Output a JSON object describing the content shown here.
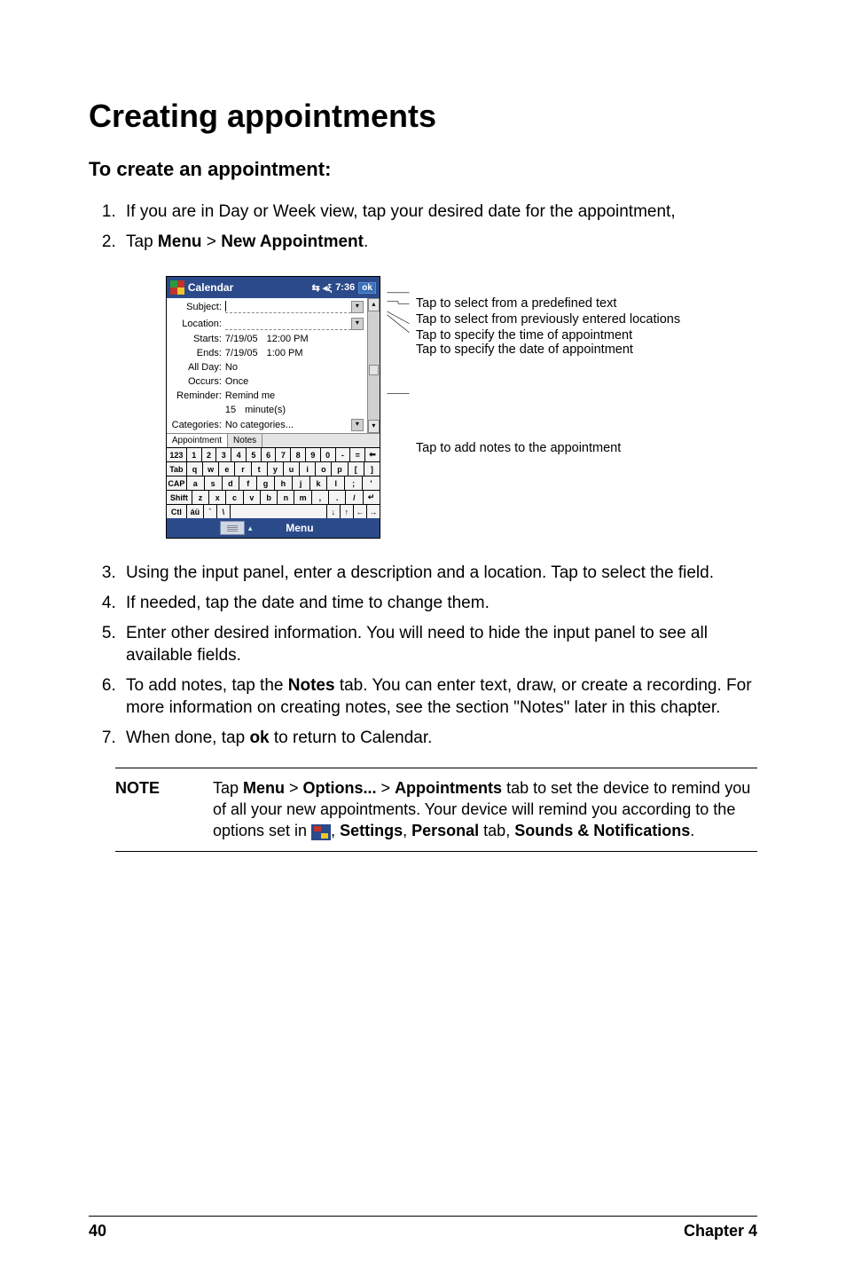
{
  "h1": "Creating appointments",
  "h2": "To create an appointment:",
  "steps_a": [
    "If you are in Day or Week view, tap your desired date for the appointment,",
    {
      "pre": "Tap ",
      "b1": "Menu",
      "mid": " > ",
      "b2": "New Appointment",
      "post": "."
    }
  ],
  "device": {
    "title": "Calendar",
    "time": "7:36",
    "ok": "ok",
    "fields": {
      "subject_lbl": "Subject:",
      "location_lbl": "Location:",
      "starts_lbl": "Starts:",
      "starts_date": "7/19/05",
      "starts_time": "12:00 PM",
      "ends_lbl": "Ends:",
      "ends_date": "7/19/05",
      "ends_time": "1:00 PM",
      "allday_lbl": "All Day:",
      "allday_val": "No",
      "occurs_lbl": "Occurs:",
      "occurs_val": "Once",
      "reminder_lbl": "Reminder:",
      "reminder_val": "Remind me",
      "reminder_num": "15",
      "reminder_unit": "minute(s)",
      "categories_lbl": "Categories:",
      "categories_val": "No categories..."
    },
    "tabs": {
      "appointment": "Appointment",
      "notes": "Notes"
    },
    "kbd": {
      "r1_lead": "123",
      "r1": [
        "1",
        "2",
        "3",
        "4",
        "5",
        "6",
        "7",
        "8",
        "9",
        "0",
        "-",
        "="
      ],
      "r1_tail": "⬅",
      "r2_lead": "Tab",
      "r2": [
        "q",
        "w",
        "e",
        "r",
        "t",
        "y",
        "u",
        "i",
        "o",
        "p",
        "[",
        "]"
      ],
      "r3_lead": "CAP",
      "r3": [
        "a",
        "s",
        "d",
        "f",
        "g",
        "h",
        "j",
        "k",
        "l",
        ";",
        "'"
      ],
      "r4_lead": "Shift",
      "r4": [
        "z",
        "x",
        "c",
        "v",
        "b",
        "n",
        "m",
        ",",
        ".",
        "/"
      ],
      "r4_tail": "↵",
      "r5_lead": "Ctl",
      "r5_1": "áü",
      "r5_2": "`",
      "r5_3": "\\",
      "r5_arrows": [
        "↓",
        "↑",
        "←",
        "→"
      ]
    },
    "softbar_menu": "Menu"
  },
  "annotations": {
    "a1": "Tap to select from a predefined text",
    "a2": "Tap to select from previously entered locations",
    "a3": "Tap to specify the time of appointment",
    "a4": "Tap to specify the date of appointment",
    "a5": "Tap to add notes to the appointment"
  },
  "steps_b": [
    "Using the input panel, enter a description and a location. Tap to select the field.",
    "If needed, tap the date and time to change them.",
    "Enter other desired information. You will need to hide the input panel to see all available fields.",
    {
      "pre": "To add notes, tap the ",
      "b1": "Notes",
      "post": " tab. You can enter text, draw, or create a recording. For more information on creating notes, see the section \"Notes\" later in this chapter."
    },
    {
      "pre": "When done, tap ",
      "b1": "ok",
      "post": " to return to Calendar."
    }
  ],
  "note": {
    "label": "NOTE",
    "t1": "Tap ",
    "b1": "Menu",
    "t2": " > ",
    "b2": "Options...",
    "t3": " > ",
    "b3": "Appointments",
    "t4": " tab to set the device to remind you of all your new appointments.  Your device will remind you according to the options set in ",
    "t5": ", ",
    "b4": "Settings",
    "t6": ", ",
    "b5": "Personal",
    "t7": " tab, ",
    "b6": "Sounds & Notifications",
    "t8": "."
  },
  "footer": {
    "page": "40",
    "chapter": "Chapter 4"
  }
}
